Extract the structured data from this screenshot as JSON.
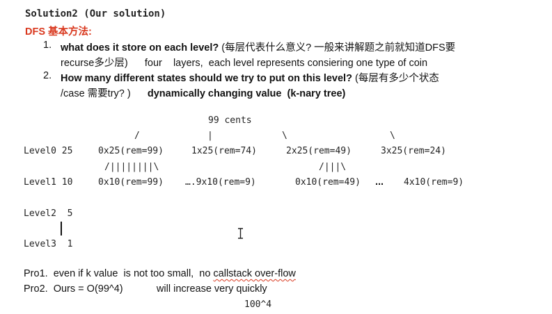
{
  "heading": "Solution2 (Our solution)",
  "dfs_title": "DFS 基本方法:",
  "items": [
    {
      "num": "1.",
      "line1_bold": "what does it store on each level? ",
      "line1_normal": "(每层代表什么意义? 一般来讲解题之前就知道DFS要",
      "line2_normal": "recurse多少层)      four    layers,  each level represents consiering one type of coin"
    },
    {
      "num": "2.",
      "line1_bold": "How many different states should we try to put on this level? ",
      "line1_normal": "(每层有多少个状态",
      "line2_normal": "/case 需要try? )      ",
      "line2_bold": "dynamically changing value  (k-nary tree)"
    }
  ],
  "tree": {
    "root": "99 cents",
    "slash_left": "/",
    "pipe_mid": "|",
    "backslash_mid": "\\",
    "backslash_right": "\\",
    "level0_prefix": "Level0 25",
    "level0_nodes": [
      "0x25(rem=99)",
      "1x25(rem=74)",
      "2x25(rem=49)",
      "3x25(rem=24)"
    ],
    "branch_a": "/||||||||\\",
    "branch_b": "/|||\\",
    "level1_prefix": "Level1 10",
    "level1_a": "0x10(rem=99)",
    "level1_b": "….9x10(rem=9)",
    "level1_c": "0x10(rem=49)",
    "level1_dots": "...",
    "level1_d": "4x10(rem=9)",
    "level2": "Level2  5",
    "level3": "Level3  1"
  },
  "pros": {
    "pro1_prefix": "Pro1.  even if k value  is not too small,  no ",
    "pro1_squiggle": "callstack over-flow",
    "pro2_prefix": "Pro2.  Ours = O(99^4)            will increase very quickly",
    "complexity_note": "100^4"
  },
  "colors": {
    "accent_red": "#d9381e",
    "text": "#111111",
    "background": "#ffffff"
  }
}
